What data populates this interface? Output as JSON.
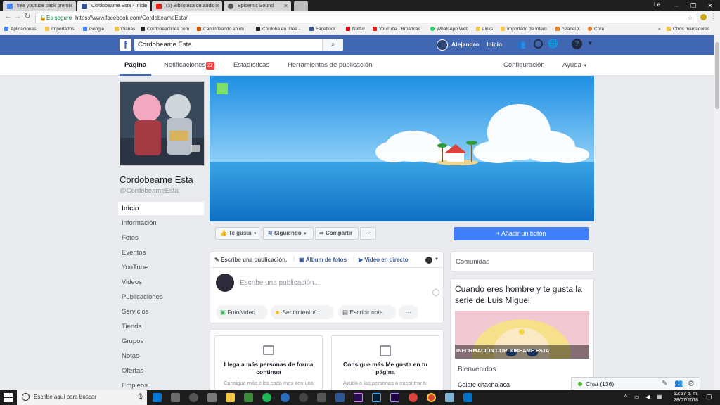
{
  "browser": {
    "tabs": [
      {
        "label": "free youtube pack premi",
        "color": "#4285f4"
      },
      {
        "label": "Cordobeame Esta - Inicio",
        "color": "#3b5998"
      },
      {
        "label": "(3) Biblioteca de audio -",
        "color": "#e62117"
      },
      {
        "label": "Epidemic Sound",
        "color": "#111111"
      }
    ],
    "profile": "Le",
    "secure_label": "Es seguro",
    "url": "https://www.facebook.com/CordobeameEsta/",
    "bookmarks": [
      {
        "label": "Aplicaciones",
        "color": "#4285f4"
      },
      {
        "label": "Importados",
        "color": "#f4c542"
      },
      {
        "label": "Google",
        "color": "#4285f4"
      },
      {
        "label": "Dianas",
        "color": "#f4c542"
      },
      {
        "label": "Cordobeenlinea.com",
        "color": "#222222"
      },
      {
        "label": "Cantinfleando en im",
        "color": "#d35400"
      },
      {
        "label": "Córdoba en línea -",
        "color": "#222222"
      },
      {
        "label": "Facebook",
        "color": "#3b5998"
      },
      {
        "label": "Netflix",
        "color": "#e50914"
      },
      {
        "label": "YouTube - Broadcas",
        "color": "#e62117"
      },
      {
        "label": "WhatsApp Web",
        "color": "#25d366"
      },
      {
        "label": "Links",
        "color": "#f4c542"
      },
      {
        "label": "Importado de Intern",
        "color": "#f4c542"
      },
      {
        "label": "cPanel X",
        "color": "#e67e22"
      },
      {
        "label": "Core",
        "color": "#e67e22"
      }
    ],
    "more_bookmarks": "»",
    "other_bookmarks": "Otros marcadores"
  },
  "fb": {
    "search_value": "Cordobeame Esta",
    "user_name": "Alejandro",
    "home": "Inicio",
    "nav": {
      "pagina": "Página",
      "notificaciones": "Notificaciones",
      "notif_count": "22",
      "estadisticas": "Estadísticas",
      "herramientas": "Herramientas de publicación",
      "configuracion": "Configuración",
      "ayuda": "Ayuda"
    },
    "page_name": "Cordobeame Esta",
    "page_handle": "@CordobeameEsta",
    "sidebar": [
      "Inicio",
      "Información",
      "Fotos",
      "Eventos",
      "YouTube",
      "Videos",
      "Publicaciones",
      "Servicios",
      "Tienda",
      "Grupos",
      "Notas",
      "Ofertas",
      "Empleos"
    ],
    "actions": {
      "like": "Te gusta",
      "follow": "Siguiendo",
      "share": "Compartir",
      "more": "···",
      "add_button": "Añadir un botón"
    },
    "composer": {
      "write": "Escribe una publicación.",
      "album": "Álbum de fotos",
      "live": "Video en directo",
      "placeholder": "Escribe una publicación...",
      "photo": "Foto/video",
      "feeling": "Sentimiento/...",
      "note": "Escribir nota",
      "more": "···"
    },
    "promo": [
      {
        "title": "Llega a más personas de forma continua",
        "sub": "Consigue más clics cada mes con una"
      },
      {
        "title": "Consigue más Me gusta en tu página",
        "sub": "Ayuda a las personas a encontrar tu"
      }
    ],
    "community": "Comunidad",
    "post_title": "Cuando eres hombre y te gusta la serie de Luis Miguel",
    "info_label": "INFORMACIÓN CORDOBEAME ESTA",
    "welcome": "Bienvenidos",
    "welcome_sub": "Calate chachalaca",
    "chat": "Chat (136)"
  },
  "taskbar": {
    "search_placeholder": "Escribe aquí para buscar",
    "time": "12:57 p. m.",
    "date": "28/07/2018"
  },
  "colors": {
    "fb_blue": "#4267b2",
    "button_blue": "#4080ff",
    "notif_red": "#fa3e3e"
  }
}
